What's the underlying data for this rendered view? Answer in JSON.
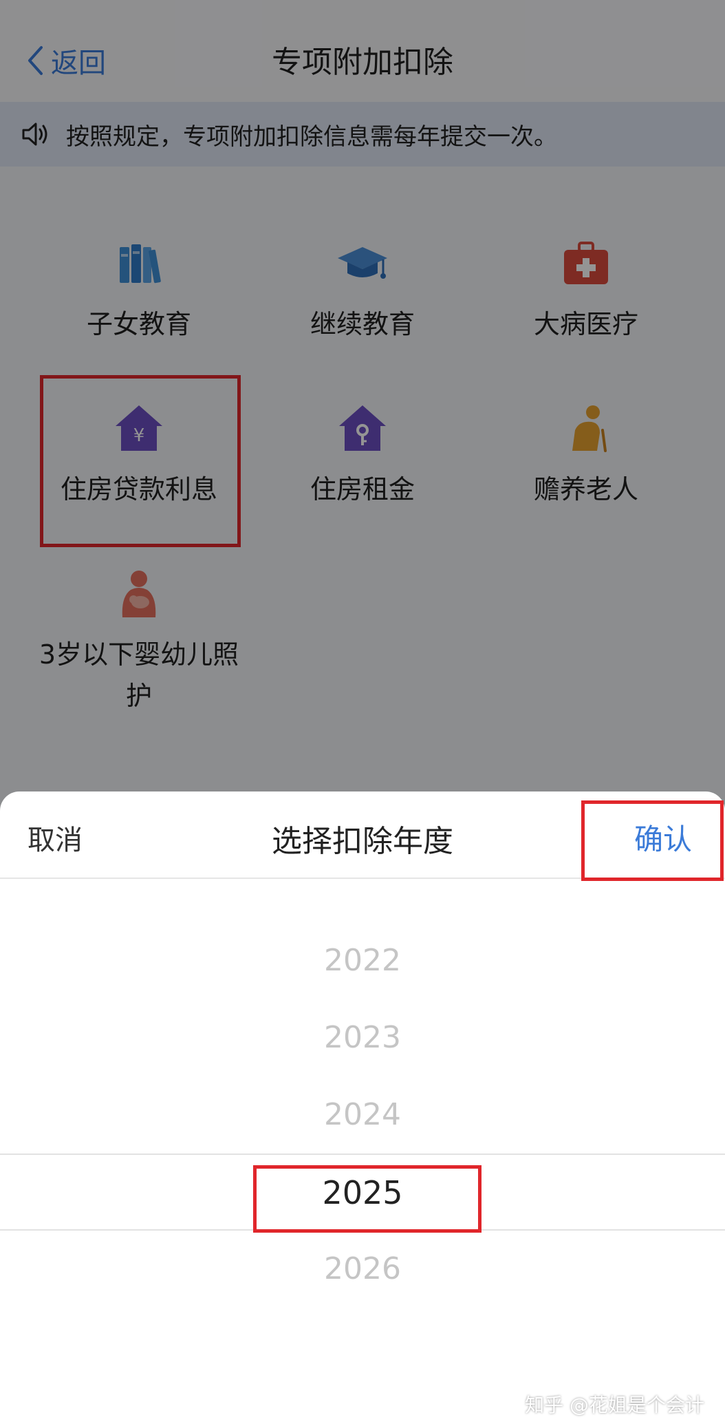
{
  "header": {
    "back_label": "返回",
    "title": "专项附加扣除"
  },
  "notice": {
    "text": "按照规定，专项附加扣除信息需每年提交一次。"
  },
  "items": [
    {
      "label": "子女教育",
      "icon": "books-icon",
      "color": "#3e8fd6"
    },
    {
      "label": "继续教育",
      "icon": "graduation-cap-icon",
      "color": "#4a8ed6"
    },
    {
      "label": "大病医疗",
      "icon": "medical-kit-icon",
      "color": "#d94a3d"
    },
    {
      "label": "住房贷款利息",
      "icon": "house-yuan-icon",
      "color": "#6c4fc2"
    },
    {
      "label": "住房租金",
      "icon": "house-key-icon",
      "color": "#6c4fc2"
    },
    {
      "label": "赡养老人",
      "icon": "elderly-person-icon",
      "color": "#e6a02f"
    },
    {
      "label_line1": "3岁以下婴幼儿照",
      "label_line2": "护",
      "icon": "mother-baby-icon",
      "color": "#e36f5d"
    }
  ],
  "sheet": {
    "cancel_label": "取消",
    "title": "选择扣除年度",
    "confirm_label": "确认",
    "years": [
      "2022",
      "2023",
      "2024",
      "2025",
      "2026"
    ],
    "selected_year": "2025"
  },
  "watermark": "知乎 @花姐是个会计",
  "colors": {
    "accent": "#3b7bd8",
    "highlight": "#e0262b"
  }
}
